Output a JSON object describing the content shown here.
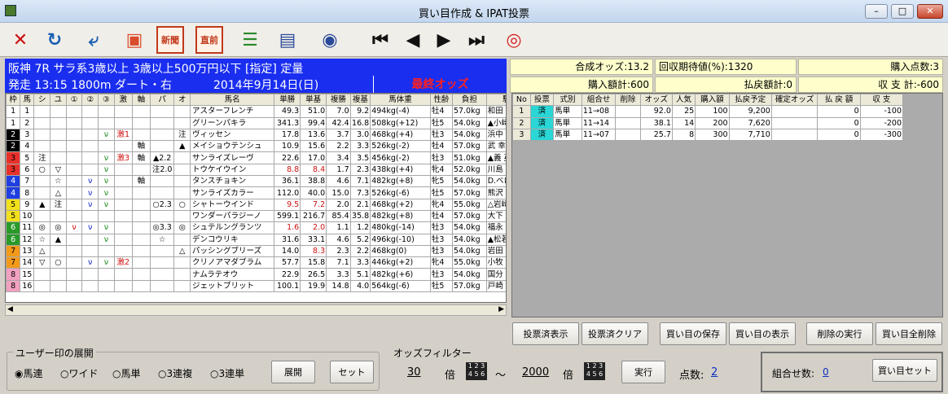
{
  "window": {
    "title": "買い目作成 & IPAT投票"
  },
  "toolbar": [
    {
      "name": "close-x-icon",
      "glyph": "✕",
      "color": "#cc1010"
    },
    {
      "name": "reload-icon",
      "glyph": "↻",
      "color": "#1a5fb4"
    },
    {
      "name": "return-icon",
      "glyph": "⤶",
      "color": "#1a5fb4"
    },
    {
      "name": "screen-icon",
      "glyph": "▣",
      "color": "#d94b2b"
    },
    {
      "name": "shinbun-icon",
      "glyph": "新聞",
      "color": "#c0391b"
    },
    {
      "name": "chokuzen-icon",
      "glyph": "直前",
      "color": "#c0391b"
    },
    {
      "name": "numbered-list-icon",
      "glyph": "☰",
      "color": "#2a8a2a"
    },
    {
      "name": "document-icon",
      "glyph": "▤",
      "color": "#2b4a9a"
    },
    {
      "name": "globe-check-icon",
      "glyph": "◉",
      "color": "#2b4a9a"
    },
    {
      "name": "first-icon",
      "glyph": "⏮",
      "color": "#111"
    },
    {
      "name": "prev-icon",
      "glyph": "◀",
      "color": "#111"
    },
    {
      "name": "next-icon",
      "glyph": "▶",
      "color": "#111"
    },
    {
      "name": "last-icon",
      "glyph": "⏭",
      "color": "#111"
    },
    {
      "name": "ipat-icon",
      "glyph": "◎",
      "color": "#d42020"
    }
  ],
  "race": {
    "line1": "阪神 7R サラ系3歳以上 3歳以上500万円以下 [指定] 定量",
    "start": "発走 13:15 1800m ダート・右",
    "date": "2014年9月14日(日)",
    "odds_status": "最終オッズ"
  },
  "summary": {
    "gosei": "合成オッズ:13.2",
    "kaishu": "回収期待値(%):1320",
    "points": "購入点数:3",
    "kounyu": "購入額計:600",
    "haraimodoshi": "払戻額計:0",
    "shushi": "収 支 計:-600"
  },
  "horses": {
    "headers": [
      "枠",
      "馬",
      "シ",
      "ユ",
      "①",
      "②",
      "③",
      "激",
      "軸",
      "パ",
      "オ",
      "馬名",
      "単勝",
      "単基",
      "複勝",
      "複基",
      "馬体重",
      "性齢",
      "負担",
      "騎"
    ],
    "rows": [
      [
        "1",
        "1",
        "",
        "",
        "",
        "",
        "",
        "",
        "",
        "",
        "",
        "アスターフレンチ",
        "49.3",
        "51.0",
        "7.0",
        "9.2",
        "494kg(-4)",
        "牡4",
        "57.0kg",
        "和田 竜"
      ],
      [
        "1",
        "2",
        "",
        "",
        "",
        "",
        "",
        "",
        "",
        "",
        "",
        "グリーンパキラ",
        "341.3",
        "99.4",
        "42.4",
        "16.8",
        "508kg(+12)",
        "牡5",
        "54.0kg",
        "▲小崎"
      ],
      [
        "2",
        "3",
        "",
        "",
        "",
        "",
        "ν",
        "激1",
        "",
        "",
        "注",
        "ヴィッセン",
        "17.8",
        "13.6",
        "3.7",
        "3.0",
        "468kg(+4)",
        "牡3",
        "54.0kg",
        "浜中 俊"
      ],
      [
        "2",
        "4",
        "",
        "",
        "",
        "",
        "",
        "",
        "軸",
        "",
        "▲",
        "メイショウテンシュ",
        "10.9",
        "15.6",
        "2.2",
        "3.3",
        "526kg(-2)",
        "牡4",
        "57.0kg",
        "武 幸四"
      ],
      [
        "3",
        "5",
        "注",
        "",
        "",
        "",
        "ν",
        "激3",
        "軸",
        "▲2.2",
        "",
        "サンライズレーヴ",
        "22.6",
        "17.0",
        "3.4",
        "3.5",
        "456kg(-2)",
        "牡3",
        "51.0kg",
        "▲義 英"
      ],
      [
        "3",
        "6",
        "○",
        "▽",
        "",
        "",
        "ν",
        "",
        "",
        "注2.0",
        "",
        "トウケイウイン",
        "8.8",
        "8.4",
        "1.7",
        "2.3",
        "438kg(+4)",
        "牝4",
        "52.0kg",
        "川島 信"
      ],
      [
        "4",
        "7",
        "",
        "☆",
        "",
        "ν",
        "ν",
        "",
        "軸",
        "",
        "",
        "タンスチョキン",
        "36.1",
        "38.8",
        "4.6",
        "7.1",
        "482kg(+8)",
        "牝5",
        "54.0kg",
        "D.ベロ"
      ],
      [
        "4",
        "8",
        "",
        "△",
        "",
        "ν",
        "ν",
        "",
        "",
        "",
        "",
        "サンライズカラー",
        "112.0",
        "40.0",
        "15.0",
        "7.3",
        "526kg(-6)",
        "牡5",
        "57.0kg",
        "熊沢 重"
      ],
      [
        "5",
        "9",
        "▲",
        "注",
        "",
        "ν",
        "ν",
        "",
        "",
        "○2.3",
        "○",
        "シャトーウインド",
        "9.5",
        "7.2",
        "2.0",
        "2.1",
        "468kg(+2)",
        "牝4",
        "55.0kg",
        "△岩崎"
      ],
      [
        "5",
        "10",
        "",
        "",
        "",
        "",
        "",
        "",
        "",
        "",
        "",
        "ワンダーパラジーノ",
        "599.1",
        "216.7",
        "85.4",
        "35.8",
        "482kg(+8)",
        "牡4",
        "57.0kg",
        "大下 智"
      ],
      [
        "6",
        "11",
        "◎",
        "◎",
        "ν",
        "ν",
        "ν",
        "",
        "",
        "◎3.3",
        "◎",
        "シュテルングランツ",
        "1.6",
        "2.0",
        "1.1",
        "1.2",
        "480kg(-14)",
        "牡3",
        "54.0kg",
        "福永 祐"
      ],
      [
        "6",
        "12",
        "☆",
        "▲",
        "",
        "",
        "ν",
        "",
        "",
        "☆",
        "",
        "デンコウリキ",
        "31.6",
        "33.1",
        "4.6",
        "5.2",
        "496kg(-10)",
        "牡3",
        "54.0kg",
        "▲松若"
      ],
      [
        "7",
        "13",
        "△",
        "",
        "",
        "",
        "",
        "",
        "",
        "",
        "△",
        "パッシングブリーズ",
        "14.0",
        "8.3",
        "2.3",
        "2.2",
        "468kg(0)",
        "牡3",
        "54.0kg",
        "岩田 康"
      ],
      [
        "7",
        "14",
        "▽",
        "○",
        "",
        "ν",
        "ν",
        "激2",
        "",
        "",
        "",
        "クリノアマダブラム",
        "57.7",
        "15.8",
        "7.1",
        "3.3",
        "446kg(+2)",
        "牝4",
        "55.0kg",
        "小牧 太"
      ],
      [
        "8",
        "15",
        "",
        "",
        "",
        "",
        "",
        "",
        "",
        "",
        "",
        "ナムラテオウ",
        "22.9",
        "26.5",
        "3.3",
        "5.1",
        "482kg(+6)",
        "牡3",
        "54.0kg",
        "国分 恭"
      ],
      [
        "8",
        "16",
        "",
        "",
        "",
        "",
        "",
        "",
        "",
        "",
        "",
        "ジェットブリット",
        "100.1",
        "19.9",
        "14.8",
        "4.0",
        "564kg(-6)",
        "牡5",
        "57.0kg",
        "戸崎 圭"
      ]
    ]
  },
  "tickets": {
    "headers": [
      "No",
      "投票",
      "式別",
      "組合せ",
      "削除",
      "オッズ",
      "人気",
      "購入額",
      "払戻予定",
      "確定オッズ",
      "払 戻 額",
      "収 支"
    ],
    "rows": [
      [
        "1",
        "済",
        "馬単",
        "11→08",
        "",
        "92.0",
        "25",
        "100",
        "9,200",
        "",
        "0",
        "-100"
      ],
      [
        "2",
        "済",
        "馬単",
        "11→14",
        "",
        "38.1",
        "14",
        "200",
        "7,620",
        "",
        "0",
        "-200"
      ],
      [
        "3",
        "済",
        "馬単",
        "11→07",
        "",
        "25.7",
        "8",
        "300",
        "7,710",
        "",
        "0",
        "-300"
      ]
    ]
  },
  "buttons": {
    "touhyozumi_hyoji": "投票済表示",
    "touhyozumi_clear": "投票済クリア",
    "save": "買い目の保存",
    "show": "買い目の表示",
    "delete_exec": "削除の実行",
    "delete_all": "買い目全削除"
  },
  "user_mark": {
    "label": "ユーザー印の展開",
    "options": [
      "馬連",
      "ワイド",
      "馬単",
      "3連複",
      "3連単"
    ],
    "selected": "馬連",
    "expand": "展開",
    "set": "セット"
  },
  "odds_filter": {
    "label": "オッズフィルター",
    "min": "30",
    "max": "2000",
    "unit": "倍",
    "tilde": "～",
    "exec": "実行",
    "count_label": "点数:",
    "count": "2"
  },
  "combo": {
    "label": "組合せ数:",
    "count": "0",
    "set": "買い目セット"
  },
  "colors": {
    "waku": [
      "#ffffff",
      "#000000",
      "#e8302a",
      "#1f3fe0",
      "#f2e01a",
      "#2a9a2a",
      "#f29a1a",
      "#f2a0c0"
    ]
  }
}
